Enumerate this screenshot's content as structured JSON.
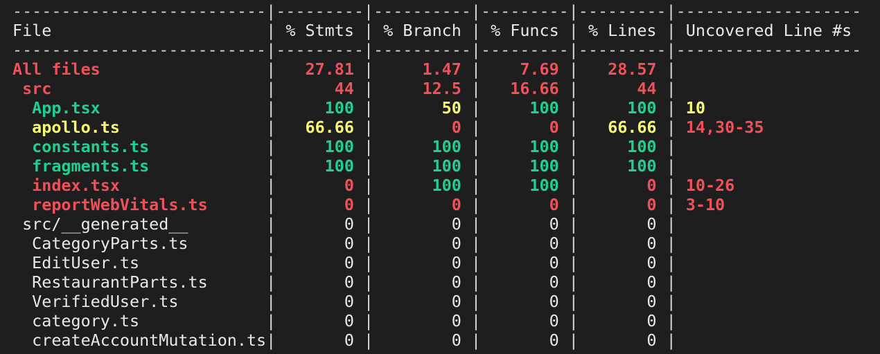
{
  "colors": {
    "background": "#1e1e1e",
    "default_text": "#e8e8e8",
    "red": "#f1505a",
    "green": "#1fd18f",
    "yellow": "#f9f871"
  },
  "separator_line": "--------------------------|---------|----------|---------|---------|-------------------",
  "header": {
    "file": "File",
    "stmts": "% Stmts",
    "branch": "% Branch",
    "funcs": "% Funcs",
    "lines": "% Lines",
    "uncovered": "Uncovered Line #s"
  },
  "rows": [
    {
      "indent": 0,
      "name": "All files",
      "stmts": "27.81",
      "branch": "1.47",
      "funcs": "7.69",
      "lines": "28.57",
      "uncovered": "",
      "color": {
        "name": "red",
        "stmts": "red",
        "branch": "red",
        "funcs": "red",
        "lines": "red",
        "uncovered": "red"
      },
      "bold": true
    },
    {
      "indent": 1,
      "name": "src",
      "stmts": "44",
      "branch": "12.5",
      "funcs": "16.66",
      "lines": "44",
      "uncovered": "",
      "color": {
        "name": "red",
        "stmts": "red",
        "branch": "red",
        "funcs": "red",
        "lines": "red",
        "uncovered": "red"
      },
      "bold": true
    },
    {
      "indent": 2,
      "name": "App.tsx",
      "stmts": "100",
      "branch": "50",
      "funcs": "100",
      "lines": "100",
      "uncovered": "10",
      "color": {
        "name": "green",
        "stmts": "green",
        "branch": "yellow",
        "funcs": "green",
        "lines": "green",
        "uncovered": "yellow"
      },
      "bold": true
    },
    {
      "indent": 2,
      "name": "apollo.ts",
      "stmts": "66.66",
      "branch": "0",
      "funcs": "0",
      "lines": "66.66",
      "uncovered": "14,30-35",
      "color": {
        "name": "yellow",
        "stmts": "yellow",
        "branch": "red",
        "funcs": "red",
        "lines": "yellow",
        "uncovered": "red"
      },
      "bold": true
    },
    {
      "indent": 2,
      "name": "constants.ts",
      "stmts": "100",
      "branch": "100",
      "funcs": "100",
      "lines": "100",
      "uncovered": "",
      "color": {
        "name": "green",
        "stmts": "green",
        "branch": "green",
        "funcs": "green",
        "lines": "green",
        "uncovered": "green"
      },
      "bold": true
    },
    {
      "indent": 2,
      "name": "fragments.ts",
      "stmts": "100",
      "branch": "100",
      "funcs": "100",
      "lines": "100",
      "uncovered": "",
      "color": {
        "name": "green",
        "stmts": "green",
        "branch": "green",
        "funcs": "green",
        "lines": "green",
        "uncovered": "green"
      },
      "bold": true
    },
    {
      "indent": 2,
      "name": "index.tsx",
      "stmts": "0",
      "branch": "100",
      "funcs": "100",
      "lines": "0",
      "uncovered": "10-26",
      "color": {
        "name": "red",
        "stmts": "red",
        "branch": "green",
        "funcs": "green",
        "lines": "red",
        "uncovered": "red"
      },
      "bold": true
    },
    {
      "indent": 2,
      "name": "reportWebVitals.ts",
      "stmts": "0",
      "branch": "0",
      "funcs": "0",
      "lines": "0",
      "uncovered": "3-10",
      "color": {
        "name": "red",
        "stmts": "red",
        "branch": "red",
        "funcs": "red",
        "lines": "red",
        "uncovered": "red"
      },
      "bold": true
    },
    {
      "indent": 1,
      "name": "src/__generated__",
      "stmts": "0",
      "branch": "0",
      "funcs": "0",
      "lines": "0",
      "uncovered": "",
      "color": {
        "name": "white",
        "stmts": "white",
        "branch": "white",
        "funcs": "white",
        "lines": "white",
        "uncovered": "white"
      },
      "bold": false
    },
    {
      "indent": 2,
      "name": "CategoryParts.ts",
      "stmts": "0",
      "branch": "0",
      "funcs": "0",
      "lines": "0",
      "uncovered": "",
      "color": {
        "name": "white",
        "stmts": "white",
        "branch": "white",
        "funcs": "white",
        "lines": "white",
        "uncovered": "white"
      },
      "bold": false
    },
    {
      "indent": 2,
      "name": "EditUser.ts",
      "stmts": "0",
      "branch": "0",
      "funcs": "0",
      "lines": "0",
      "uncovered": "",
      "color": {
        "name": "white",
        "stmts": "white",
        "branch": "white",
        "funcs": "white",
        "lines": "white",
        "uncovered": "white"
      },
      "bold": false
    },
    {
      "indent": 2,
      "name": "RestaurantParts.ts",
      "stmts": "0",
      "branch": "0",
      "funcs": "0",
      "lines": "0",
      "uncovered": "",
      "color": {
        "name": "white",
        "stmts": "white",
        "branch": "white",
        "funcs": "white",
        "lines": "white",
        "uncovered": "white"
      },
      "bold": false
    },
    {
      "indent": 2,
      "name": "VerifiedUser.ts",
      "stmts": "0",
      "branch": "0",
      "funcs": "0",
      "lines": "0",
      "uncovered": "",
      "color": {
        "name": "white",
        "stmts": "white",
        "branch": "white",
        "funcs": "white",
        "lines": "white",
        "uncovered": "white"
      },
      "bold": false
    },
    {
      "indent": 2,
      "name": "category.ts",
      "stmts": "0",
      "branch": "0",
      "funcs": "0",
      "lines": "0",
      "uncovered": "",
      "color": {
        "name": "white",
        "stmts": "white",
        "branch": "white",
        "funcs": "white",
        "lines": "white",
        "uncovered": "white"
      },
      "bold": false
    },
    {
      "indent": 2,
      "name": "createAccountMutation.ts",
      "stmts": "0",
      "branch": "0",
      "funcs": "0",
      "lines": "0",
      "uncovered": "",
      "color": {
        "name": "white",
        "stmts": "white",
        "branch": "white",
        "funcs": "white",
        "lines": "white",
        "uncovered": "white"
      },
      "bold": false
    }
  ]
}
